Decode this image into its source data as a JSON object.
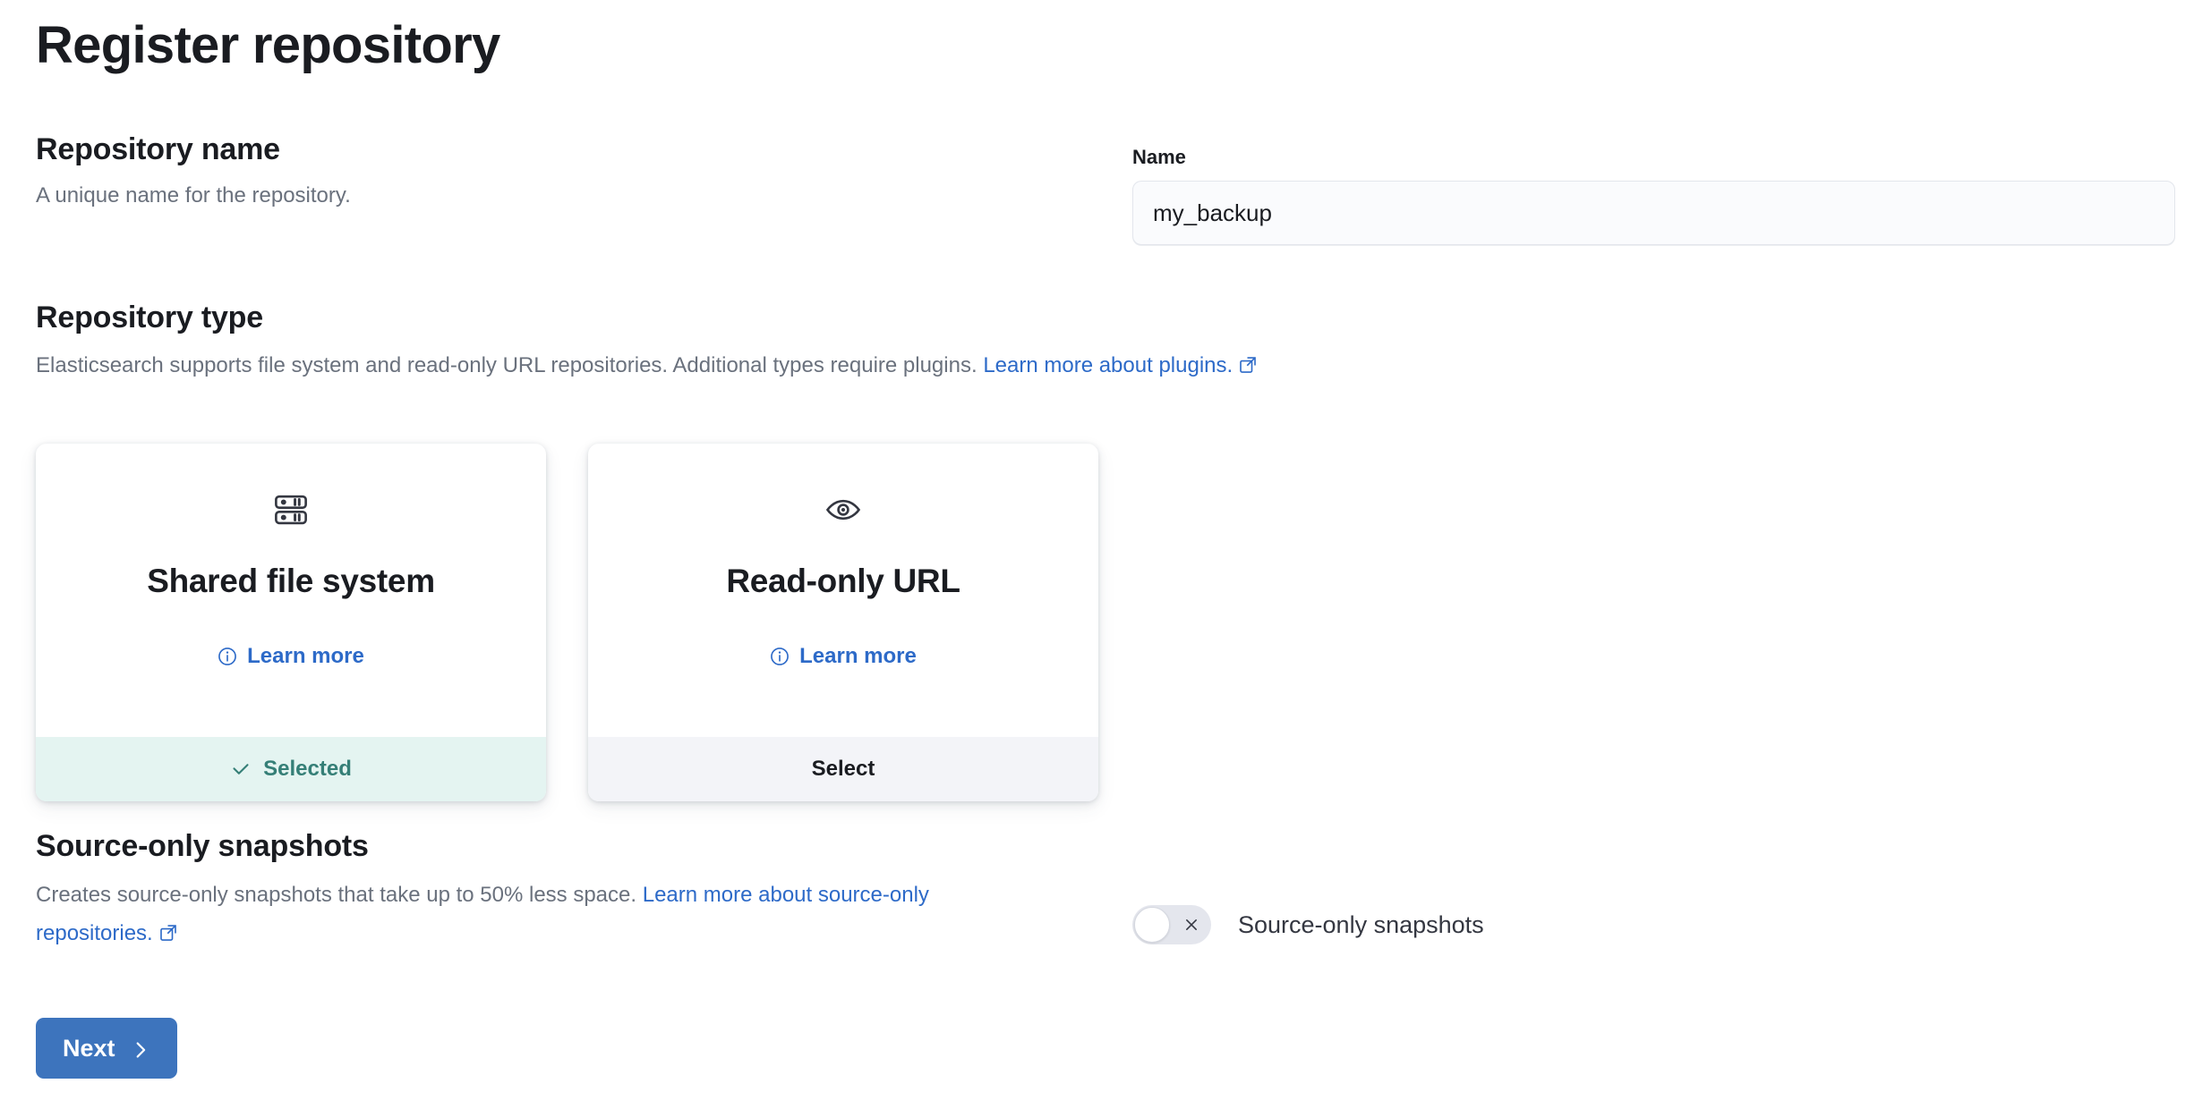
{
  "page": {
    "title": "Register repository"
  },
  "repository_name": {
    "heading": "Repository name",
    "description": "A unique name for the repository.",
    "field_label": "Name",
    "value": "my_backup",
    "placeholder": ""
  },
  "repository_type": {
    "heading": "Repository type",
    "description_text": "Elasticsearch supports file system and read-only URL repositories. Additional types require plugins.",
    "description_link": "Learn more about plugins.",
    "cards": [
      {
        "icon": "storage-rack-icon",
        "title": "Shared file system",
        "learn_more": "Learn more",
        "footer_label": "Selected",
        "selected": true
      },
      {
        "icon": "eye-icon",
        "title": "Read-only URL",
        "learn_more": "Learn more",
        "footer_label": "Select",
        "selected": false
      }
    ]
  },
  "source_only": {
    "heading": "Source-only snapshots",
    "description_text": "Creates source-only snapshots that take up to 50% less space.",
    "description_link": "Learn more about source-only repositories.",
    "toggle_label": "Source-only snapshots",
    "toggle_on": false
  },
  "footer": {
    "next_label": "Next"
  },
  "colors": {
    "link": "#2d6ac8",
    "primary_button": "#3d74bd",
    "selected_bg": "#e4f4f1",
    "selected_text": "#357f77",
    "select_bg": "#f3f4f8",
    "text": "#1a1c21",
    "muted_text": "#6a717d"
  }
}
